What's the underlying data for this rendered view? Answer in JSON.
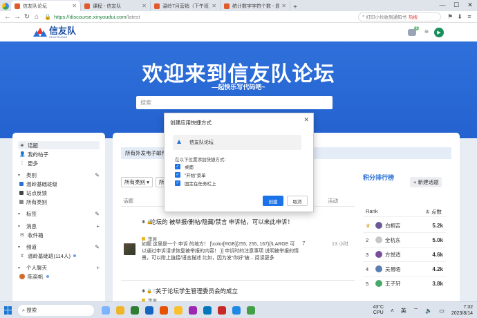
{
  "browser": {
    "tabs": [
      {
        "label": "信友队论坛",
        "color": "#e05a2b",
        "active": true
      },
      {
        "label": "课程 - 信友队",
        "color": "#e05a2b",
        "active": false
      },
      {
        "label": "温岭7月营销（下午班）- 讲",
        "color": "#e05a2b",
        "active": false
      },
      {
        "label": "统计数字字符个数 - 题目详情",
        "color": "#e05a2b",
        "active": false
      }
    ],
    "url_host": "https://discourse.xinyoudui.com",
    "url_path": "/latest",
    "search_pill": "打印小伙收到通知书",
    "search_hot": "热搜"
  },
  "site": {
    "logo_name": "信友队",
    "logo_sub": "XINYOUDUI",
    "notif_count": "1",
    "user_initial": "▶"
  },
  "banner": {
    "title": "欢迎来到信友队论坛",
    "subtitle": "—起快乐写代码吧~",
    "search_placeholder": "搜索"
  },
  "sidebar": {
    "top": [
      {
        "icon": "layers-icon",
        "glyph": "◈",
        "label": "话题",
        "active": true
      },
      {
        "icon": "user-icon",
        "glyph": "👤",
        "label": "我的帖子",
        "active": false
      },
      {
        "icon": "more-icon",
        "glyph": "⋮",
        "label": "更多",
        "active": false
      }
    ],
    "sections": [
      {
        "title": "类别",
        "action": "✎",
        "items": [
          {
            "label": "温岭基础班级",
            "color": "#2b6fd6",
            "dot": false
          },
          {
            "label": "站点反馈",
            "color": "#444",
            "dot": false
          },
          {
            "label": "所有类别",
            "color": "#888",
            "dot": false
          }
        ]
      },
      {
        "title": "标签",
        "action": "✎",
        "items": []
      },
      {
        "title": "消息",
        "action": "+",
        "items": [
          {
            "label": "收件箱",
            "color": "",
            "dot": false
          }
        ]
      },
      {
        "title": "频道",
        "action": "✎",
        "items": [
          {
            "label": "温岭基础班(114人)",
            "color": "",
            "dot": true
          }
        ]
      },
      {
        "title": "个人聊天",
        "action": "+",
        "items": [
          {
            "label": "陈奕帆",
            "color": "",
            "dot": true
          }
        ]
      }
    ]
  },
  "main": {
    "notice": "所有外发电子邮件",
    "filters": [
      "所有类别",
      "所"
    ],
    "new_topic": "+ 新建话题",
    "col_topic": "话题",
    "col_activity": "活动",
    "topics": [
      {
        "flags": "✱ 🔒",
        "title": "论坛的 被举报/删帖/隐藏/禁言 申诉帖，可以来此申诉！",
        "category": "策展",
        "excerpt": "如题 这里是一个 申诉 的地方！ [\\color[RGB]{255, 255, 167}{\\LARGE 可以通过申诉请求恢复被举报的内容！ }] 申诉时的注意事项 说明被举报的情景，可以附上链接/语言描述 比如，因为发\"你好\"被... 阅读更多",
        "replies": "7",
        "activity": "13 小时"
      },
      {
        "flags": "✱ 🔒 ☐",
        "title": "关于论坛学生管理委员会的成立",
        "category": "策展",
        "excerpt": "",
        "replies": "",
        "activity": ""
      }
    ]
  },
  "leaderboard": {
    "title": "积分排行榜",
    "col_rank": "Rank",
    "col_points": "点数",
    "rows": [
      {
        "rank": "♛",
        "name": "白桐吉",
        "score": "5.2k",
        "color": "#6b5b95"
      },
      {
        "rank": "2",
        "name": "全杭东",
        "score": "5.0k",
        "color": "#c7c7c7"
      },
      {
        "rank": "3",
        "name": "方悦适",
        "score": "4.6k",
        "color": "#7a4f9a"
      },
      {
        "rank": "4",
        "name": "吴易晤",
        "score": "4.2k",
        "color": "#5a7fb0"
      },
      {
        "rank": "5",
        "name": "王子轩",
        "score": "3.8k",
        "color": "#4aa86b"
      }
    ]
  },
  "dialog": {
    "title": "创建应用快捷方式",
    "app_name": "信友队论坛",
    "location_label": "在以下位置添加快捷方式:",
    "options": [
      "桌面",
      "\"开始\"菜单",
      "固定在任务栏上"
    ],
    "create": "创建",
    "cancel": "取消"
  },
  "taskbar": {
    "search": "搜索",
    "apps": [
      "#7fb3ff",
      "#f0b429",
      "#2e7d32",
      "#1565c0",
      "#e65100",
      "#fbc02d",
      "#9c27b0",
      "#0277bd",
      "#c62828",
      "#1e88e5",
      "#43a047"
    ],
    "weather_temp": "43°C",
    "weather_label": "CPU",
    "ime": "英",
    "time": "7:32",
    "date": "2023/8/14"
  }
}
